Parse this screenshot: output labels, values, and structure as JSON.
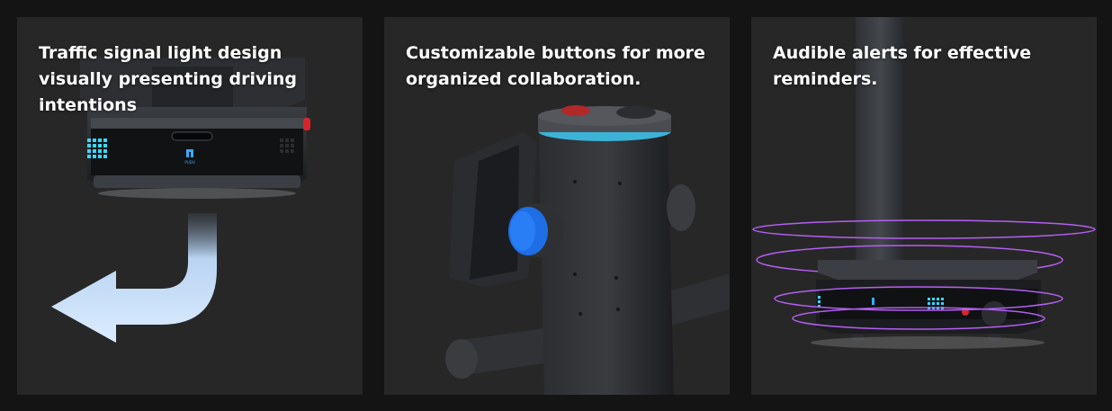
{
  "features": [
    {
      "title": "Traffic signal light design visually presenting driving intentions",
      "image": "robot-base-with-signal-lights-and-turn-arrow",
      "logo": "PUDU"
    },
    {
      "title": "Customizable buttons for more organized collaboration.",
      "image": "robot-column-with-blue-button-and-emergency-stop"
    },
    {
      "title": "Audible alerts for effective reminders.",
      "image": "robot-with-pole-and-purple-sound-rings"
    }
  ],
  "colors": {
    "page_background": "#141414",
    "card_background": "#272727",
    "title_text": "#ffffff",
    "arrow": "#d4e8ff",
    "signal_light": "#38d8ff",
    "button_blue": "#1e6ee6",
    "sound_rings": "#b45ff0"
  }
}
